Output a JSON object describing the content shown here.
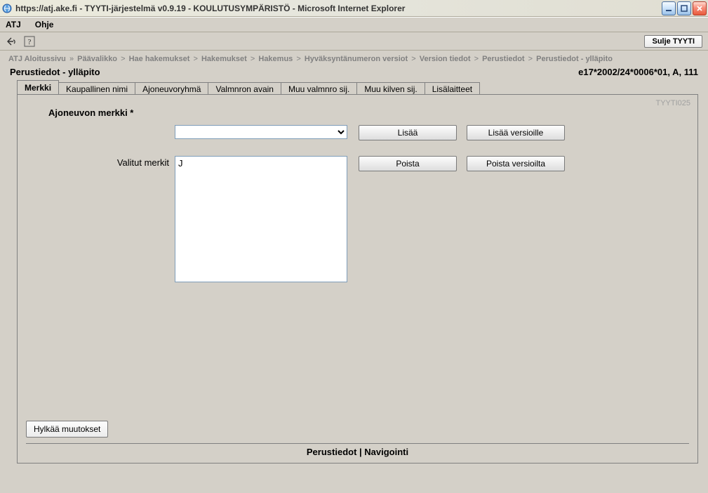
{
  "window": {
    "title": "https://atj.ake.fi - TYYTI-järjestelmä v0.9.19 - KOULUTUSYMPÄRISTÖ - Microsoft Internet Explorer"
  },
  "menubar": {
    "items": [
      "ATJ",
      "Ohje"
    ]
  },
  "toolbar": {
    "close_app_label": "Sulje TYYTI"
  },
  "breadcrumb": {
    "items": [
      "ATJ Aloitussivu",
      "Päävalikko",
      "Hae hakemukset",
      "Hakemukset",
      "Hakemus",
      "Hyväksyntänumeron versiot",
      "Version tiedot",
      "Perustiedot"
    ],
    "sep_first": "»",
    "sep_rest": ">",
    "current": "Perustiedot - ylläpito"
  },
  "page": {
    "title": "Perustiedot - ylläpito",
    "code": "e17*2002/24*0006*01, A, 111"
  },
  "tabs": {
    "items": [
      "Merkki",
      "Kaupallinen nimi",
      "Ajoneuvoryhmä",
      "Valmnron avain",
      "Muu valmnro sij.",
      "Muu kilven sij.",
      "Lisälaitteet"
    ],
    "active_index": 0
  },
  "panel": {
    "code": "TYYTI025",
    "merkki_label": "Ajoneuvon merkki *",
    "valitut_label": "Valitut merkit",
    "listbox_item": "J",
    "buttons": {
      "lisaa": "Lisää",
      "lisaa_versioille": "Lisää versioille",
      "poista": "Poista",
      "poista_versioilta": "Poista versioilta",
      "hylkaa": "Hylkää muutokset"
    }
  },
  "footer": {
    "text": "Perustiedot | Navigointi"
  }
}
